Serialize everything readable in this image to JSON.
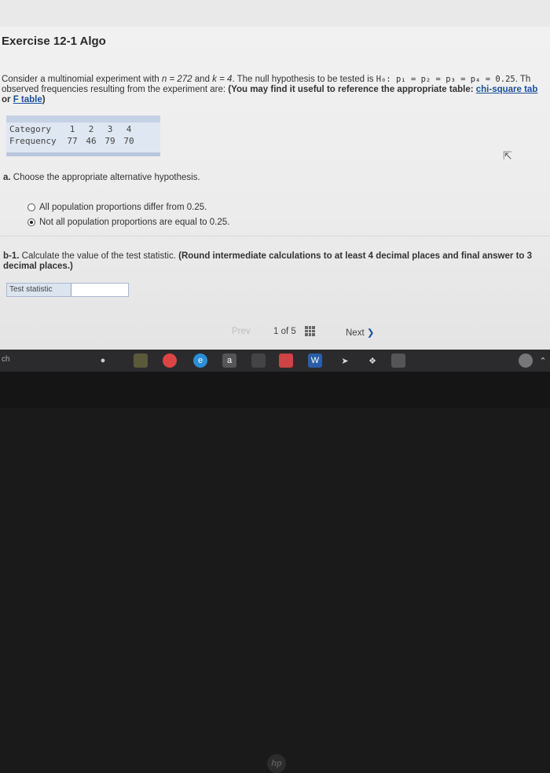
{
  "exercise": {
    "title": "Exercise 12-1 Algo"
  },
  "prompt": {
    "line1_a": "Consider a multinomial experiment with ",
    "n_expr": "n = 272",
    "and": " and ",
    "k_expr": "k = 4",
    "line1_b": ". The null hypothesis to be tested is ",
    "h0": "H₀: p₁ = p₂ = p₃ = p₄ = 0.25",
    "h0_tail": ". Th",
    "line2_a": "observed frequencies resulting from the experiment are: ",
    "line2_bold": "(You may find it useful to reference the appropriate table: ",
    "link_chi": "chi-square tab",
    "line3_or": "or ",
    "link_f": "F table",
    "line3_close": ")"
  },
  "table": {
    "row1_label": "Category",
    "categories": [
      "1",
      "2",
      "3",
      "4"
    ],
    "row2_label": "Frequency",
    "frequencies": [
      "77",
      "46",
      "79",
      "70"
    ]
  },
  "part_a": {
    "label": "a.",
    "question": "Choose the appropriate alternative hypothesis.",
    "options": [
      {
        "text": "All population proportions differ from 0.25.",
        "selected": false
      },
      {
        "text": "Not all population proportions are equal to 0.25.",
        "selected": true
      }
    ]
  },
  "part_b1": {
    "label": "b-1.",
    "question": "Calculate the value of the test statistic.",
    "instruction": "(Round intermediate calculations to at least 4 decimal places and final answer to 3 decimal places.)",
    "input_label": "Test statistic",
    "input_value": ""
  },
  "pager": {
    "prev": "Prev",
    "current": "1",
    "of": "of",
    "total": "5",
    "next": "Next"
  },
  "taskbar": {
    "left_text": "ch"
  },
  "colors": {
    "link": "#1a4f9c",
    "table_bg": "#dfe7f2",
    "taskbar": "#2b2b2e"
  }
}
